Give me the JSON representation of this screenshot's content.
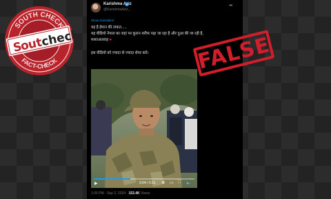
{
  "stamp": {
    "top_text": "SOUTH CHECK",
    "bottom_text": "FACT-CHECK",
    "brand": "South Check"
  },
  "tweet": {
    "author_name": "Karishma Aziz",
    "handle": "@KarishmaAziz_",
    "show_translation": "Show translation",
    "lines": [
      "यह है ईमान की ताकत.....",
      "यह वीडियो नेपाल का जहां पर कुरान शरीफ पढ़ा जा रहा है और दुआ की जा रही है,",
      "माशाअल्लाह",
      "इस वीडियो को ज्यादा से ज्यादा शेयर करें।"
    ],
    "video_time": "0:04 / 0:11",
    "post_time": "1:06 PM · Sep 2, 2024 ·",
    "views_count": "153.4K",
    "views_label": "Views"
  },
  "verdict": {
    "label": "FALSE",
    "color": "#d21e2a"
  }
}
